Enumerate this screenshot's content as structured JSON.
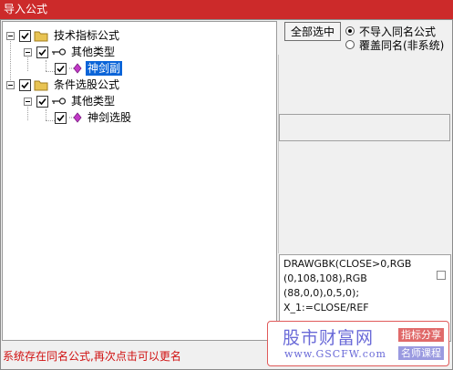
{
  "window": {
    "title": "导入公式"
  },
  "tree": {
    "items": [
      {
        "label": "技术指标公式",
        "checked": true,
        "icon": "folder-icon"
      },
      {
        "label": "其他类型",
        "checked": true,
        "icon": "key-icon"
      },
      {
        "label": "神剑副",
        "checked": true,
        "icon": "diamond-icon",
        "selected": true
      },
      {
        "label": "条件选股公式",
        "checked": true,
        "icon": "folder-icon"
      },
      {
        "label": "其他类型",
        "checked": true,
        "icon": "key-icon"
      },
      {
        "label": "神剑选股",
        "checked": true,
        "icon": "diamond-icon"
      }
    ]
  },
  "options": {
    "select_all_label": "全部选中",
    "radio_skip_label": "不导入同名公式",
    "radio_overwrite_label": "覆盖同名(非系统)",
    "selected": "skip"
  },
  "code_preview": {
    "lines": [
      "DRAWGBK(CLOSE>0,RGB",
      "(0,108,108),RGB",
      "(88,0,0),0,5,0);",
      "X_1:=CLOSE/REF"
    ]
  },
  "status_text": "系统存在同名公式,再次点击可以更名",
  "watermark": {
    "cn_text": "股市财富网",
    "url": "www.GSCFW.com",
    "tag1": "指标分享",
    "tag2": "名师课程"
  },
  "colors": {
    "titlebar": "#cc2a2a",
    "selection": "#0a64d8",
    "status_text": "#d01010",
    "folder": "#e8c352",
    "diamond": "#c23ac7"
  }
}
